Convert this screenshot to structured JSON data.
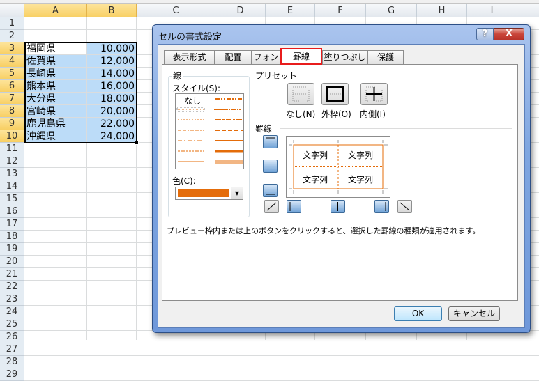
{
  "sheet": {
    "columns": [
      "A",
      "B",
      "C",
      "D",
      "E",
      "F",
      "G",
      "H",
      "I"
    ],
    "selected_columns": [
      "A",
      "B"
    ],
    "row_count": 29,
    "selected_rows": [
      3,
      10
    ],
    "data_rows": [
      {
        "row": 3,
        "a": "福岡県",
        "b": "10,000"
      },
      {
        "row": 4,
        "a": "佐賀県",
        "b": "12,000"
      },
      {
        "row": 5,
        "a": "長崎県",
        "b": "14,000"
      },
      {
        "row": 6,
        "a": "熊本県",
        "b": "16,000"
      },
      {
        "row": 7,
        "a": "大分県",
        "b": "18,000"
      },
      {
        "row": 8,
        "a": "宮崎県",
        "b": "20,000"
      },
      {
        "row": 9,
        "a": "鹿児島県",
        "b": "22,000"
      },
      {
        "row": 10,
        "a": "沖縄県",
        "b": "24,000"
      }
    ],
    "selection_color": "#bcdcf8"
  },
  "dialog": {
    "title": "セルの書式設定",
    "help_label": "?",
    "close_label": "X",
    "tabs": [
      {
        "label": "表示形式",
        "active": false
      },
      {
        "label": "配置",
        "active": false
      },
      {
        "label": "フォント",
        "active": false
      },
      {
        "label": "罫線",
        "active": true
      },
      {
        "label": "塗りつぶし",
        "active": false
      },
      {
        "label": "保護",
        "active": false
      }
    ],
    "line_group": {
      "title": "線",
      "style_label": "スタイル(S):",
      "none_label": "なし",
      "color_label": "色(C):",
      "color_value": "#e46c0a"
    },
    "preset": {
      "title": "プリセット",
      "buttons": [
        {
          "label": "なし(N)",
          "icon": "border-none-icon"
        },
        {
          "label": "外枠(O)",
          "icon": "border-outline-icon"
        },
        {
          "label": "内側(I)",
          "icon": "border-inside-icon"
        }
      ]
    },
    "border": {
      "title": "罫線",
      "preview_cells": [
        "文字列",
        "文字列",
        "文字列",
        "文字列"
      ],
      "border_color": "#e46c0a"
    },
    "description": "プレビュー枠内または上のボタンをクリックすると、選択した罫線の種類が適用されます。",
    "ok_label": "OK",
    "cancel_label": "キャンセル"
  }
}
